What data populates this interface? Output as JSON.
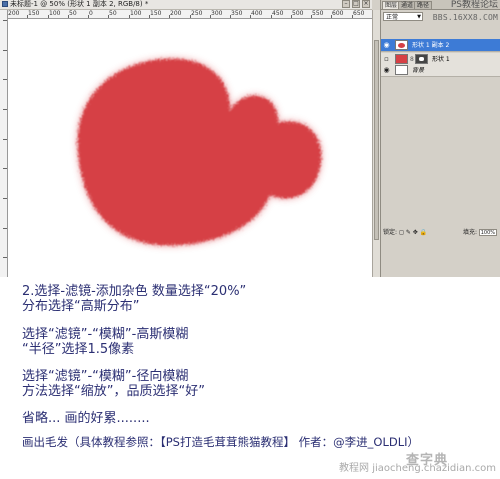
{
  "document": {
    "title": "未标题-1 @ 50% (形状 1 副本 2, RGB/8) *",
    "window_buttons": [
      "–",
      "□",
      "×"
    ],
    "ruler_top_labels": [
      "200",
      "150",
      "100",
      "50",
      "0",
      "50",
      "100",
      "150",
      "200",
      "250",
      "300",
      "350",
      "400",
      "450",
      "500",
      "550",
      "600",
      "650"
    ],
    "ruler_left_labels": [
      "1",
      "2",
      "3",
      "4",
      "5",
      "6",
      "7",
      "8",
      "9"
    ]
  },
  "panel": {
    "tabs": [
      "图层",
      "通道",
      "路径"
    ],
    "watermark_top": "PS教程论坛",
    "watermark_url": "BBS.16XX8.COM",
    "blend_mode": "正常",
    "lock_label": "锁定:",
    "fill_label": "填充:",
    "fill_value": "100%",
    "layers": [
      {
        "name": "形状 1 副本 2",
        "selected": true
      },
      {
        "name": "形状 1",
        "selected": false
      },
      {
        "name": "背景",
        "selected": false
      }
    ]
  },
  "tutorial": {
    "lines": [
      "2.选择-滤镜-添加杂色  数量选择“20%”",
      "分布选择“高斯分布”",
      "选择“滤镜”-“模糊”-高斯模糊",
      "“半径”选择1.5像素",
      "选择“滤镜”-“模糊”-径向模糊",
      "方法选择“缩放”，品质选择“好”",
      "省略... 画的好累........",
      "画出毛发（具体教程参照：【PS打造毛茸茸熊猫教程】 作者：@李进_OLDLI）"
    ],
    "site_mark_big": "查字典",
    "site_mark_small": "教程网 jiaocheng.chazidian.com"
  },
  "colors": {
    "fur_red": "#d64045",
    "text_navy": "#2b2f73",
    "selected_layer": "#3d7bd6"
  }
}
